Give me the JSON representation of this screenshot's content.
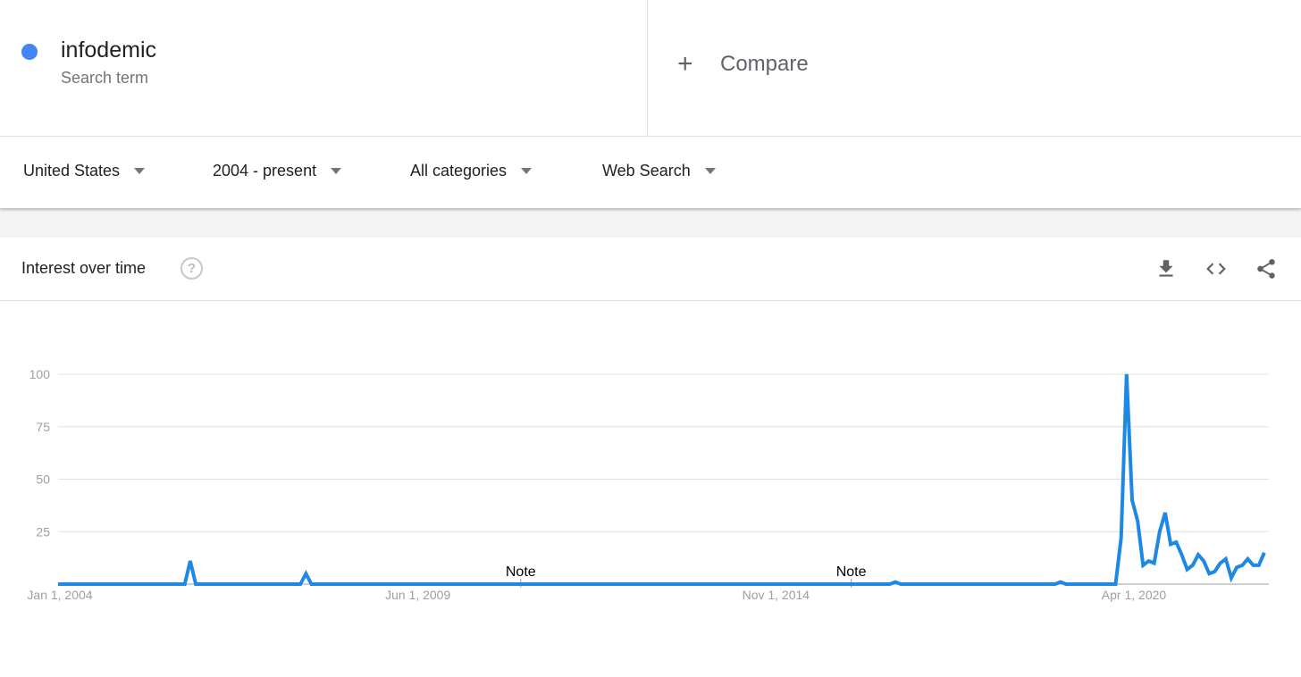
{
  "search_term": {
    "name": "infodemic",
    "type_label": "Search term",
    "color": "#4285f4"
  },
  "compare": {
    "icon": "plus-icon",
    "label": "Compare"
  },
  "filters": [
    {
      "label": "United States",
      "icon": "caret-down-icon"
    },
    {
      "label": "2004 - present",
      "icon": "caret-down-icon"
    },
    {
      "label": "All categories",
      "icon": "caret-down-icon"
    },
    {
      "label": "Web Search",
      "icon": "caret-down-icon"
    }
  ],
  "panel": {
    "title": "Interest over time",
    "help_icon": "help-circle-icon",
    "actions": [
      "download-icon",
      "embed-code-icon",
      "share-icon"
    ]
  },
  "chart_data": {
    "type": "line",
    "title": "Interest over time",
    "xlabel": "",
    "ylabel": "",
    "ylim": [
      0,
      100
    ],
    "yticks": [
      25,
      50,
      75,
      100
    ],
    "ytick_labels": [
      "25",
      "50",
      "75",
      "100"
    ],
    "xtick_labels": [
      "Jan 1, 2004",
      "Jun 1, 2009",
      "Nov 1, 2014",
      "Apr 1, 2020"
    ],
    "xtick_month_index": [
      0,
      65,
      130,
      195
    ],
    "x_start": "2004-01",
    "x_step": "month",
    "grid": true,
    "legend": "none",
    "line_color": "#1e88e5",
    "annotations": [
      {
        "text": "Note",
        "month_index": 84
      },
      {
        "text": "Note",
        "month_index": 144
      }
    ],
    "series": [
      {
        "name": "infodemic",
        "values": [
          0,
          0,
          0,
          0,
          0,
          0,
          0,
          0,
          0,
          0,
          0,
          0,
          0,
          0,
          0,
          0,
          0,
          0,
          0,
          0,
          0,
          0,
          0,
          0,
          11,
          0,
          0,
          0,
          0,
          0,
          0,
          0,
          0,
          0,
          0,
          0,
          0,
          0,
          0,
          0,
          0,
          0,
          0,
          0,
          0,
          5,
          0,
          0,
          0,
          0,
          0,
          0,
          0,
          0,
          0,
          0,
          0,
          0,
          0,
          0,
          0,
          0,
          0,
          0,
          0,
          0,
          0,
          0,
          0,
          0,
          0,
          0,
          0,
          0,
          0,
          0,
          0,
          0,
          0,
          0,
          0,
          0,
          0,
          0,
          0,
          0,
          0,
          0,
          0,
          0,
          0,
          0,
          0,
          0,
          0,
          0,
          0,
          0,
          0,
          0,
          0,
          0,
          0,
          0,
          0,
          0,
          0,
          0,
          0,
          0,
          0,
          0,
          0,
          0,
          0,
          0,
          0,
          0,
          0,
          0,
          0,
          0,
          0,
          0,
          0,
          0,
          0,
          0,
          0,
          0,
          0,
          0,
          0,
          0,
          0,
          0,
          0,
          0,
          0,
          0,
          0,
          0,
          0,
          0,
          0,
          0,
          0,
          0,
          0,
          0,
          0,
          0,
          1,
          0,
          0,
          0,
          0,
          0,
          0,
          0,
          0,
          0,
          0,
          0,
          0,
          0,
          0,
          0,
          0,
          0,
          0,
          0,
          0,
          0,
          0,
          0,
          0,
          0,
          0,
          0,
          0,
          0,
          1,
          0,
          0,
          0,
          0,
          0,
          0,
          0,
          0,
          0,
          0,
          22,
          100,
          40,
          30,
          9,
          11,
          10,
          25,
          34,
          19,
          20,
          14,
          7,
          9,
          14,
          11,
          5,
          6,
          10,
          12,
          3,
          8,
          9,
          12,
          9,
          9,
          15
        ]
      }
    ]
  }
}
